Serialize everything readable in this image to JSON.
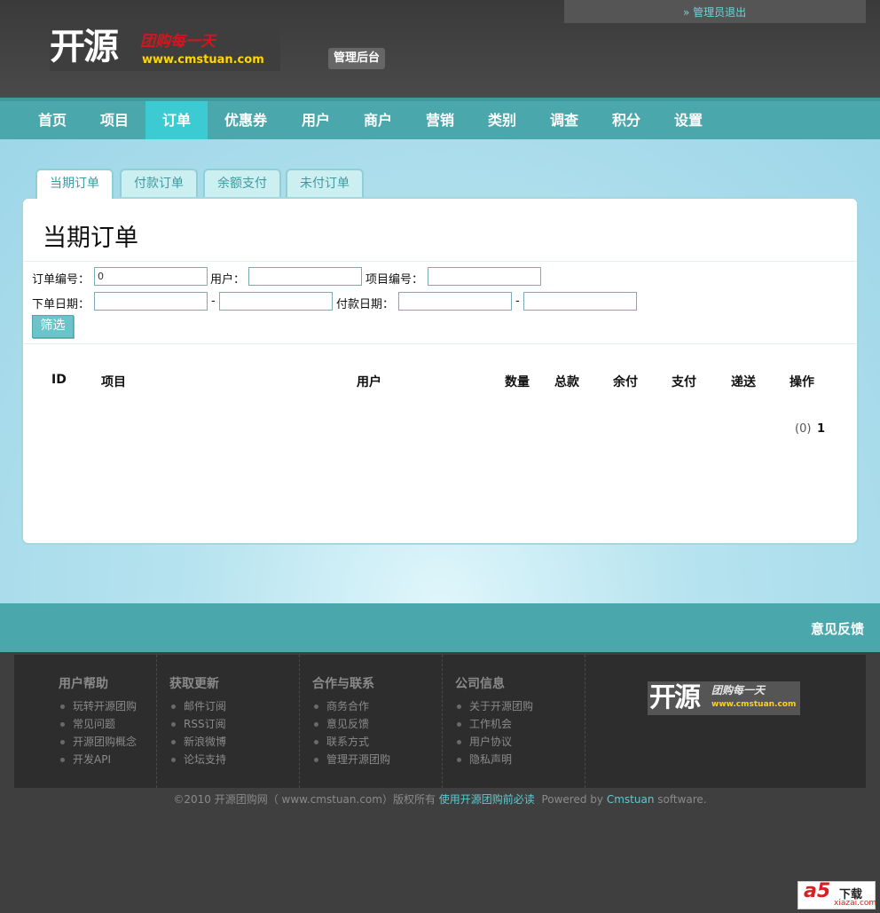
{
  "header": {
    "logout": "» 管理员退出",
    "logo_main": "开源",
    "logo_slogan": "团购每一天",
    "logo_url": "www.cmstuan.com",
    "admin_badge": "管理后台"
  },
  "nav": [
    "首页",
    "项目",
    "订单",
    "优惠券",
    "用户",
    "商户",
    "营销",
    "类别",
    "调查",
    "积分",
    "设置"
  ],
  "nav_active": "订单",
  "tabs": [
    "当期订单",
    "付款订单",
    "余额支付",
    "未付订单"
  ],
  "tab_active": "当期订单",
  "panel": {
    "title": "当期订单",
    "filters": {
      "order_no_label": "订单编号：",
      "order_no_value": "0",
      "user_label": "用户：",
      "project_no_label": "项目编号：",
      "order_date_label": "下单日期：",
      "dash": "-",
      "pay_date_label": "付款日期：",
      "submit": "筛选"
    },
    "columns": [
      "ID",
      "项目",
      "用户",
      "数量",
      "总款",
      "余付",
      "支付",
      "递送",
      "操作"
    ],
    "pager": {
      "count": "(0)",
      "page": "1"
    }
  },
  "feedback": "意见反馈",
  "footer": {
    "columns": [
      {
        "title": "用户帮助",
        "items": [
          "玩转开源团购",
          "常见问题",
          "开源团购概念",
          "开发API"
        ]
      },
      {
        "title": "获取更新",
        "items": [
          "邮件订阅",
          "RSS订阅",
          "新浪微博",
          "论坛支持"
        ]
      },
      {
        "title": "合作与联系",
        "items": [
          "商务合作",
          "意见反馈",
          "联系方式",
          "管理开源团购"
        ]
      },
      {
        "title": "公司信息",
        "items": [
          "关于开源团购",
          "工作机会",
          "用户协议",
          "隐私声明"
        ]
      }
    ],
    "logo_main": "开源",
    "logo_slogan": "团购每一天",
    "logo_url": "www.cmstuan.com"
  },
  "copyright": {
    "text": "©2010 开源团购网（ www.cmstuan.com）版权所有",
    "link": "使用开源团购前必读",
    "powered_pre": "Powered by",
    "powered_link": "Cmstuan",
    "powered_post": "software."
  },
  "watermark": {
    "main": "a5",
    "dl": "下载",
    "sub": "xiazai.com"
  },
  "colors": {
    "teal": "#4aa7ac",
    "nav_active": "#3ccbd2",
    "link": "#5ecad0"
  }
}
